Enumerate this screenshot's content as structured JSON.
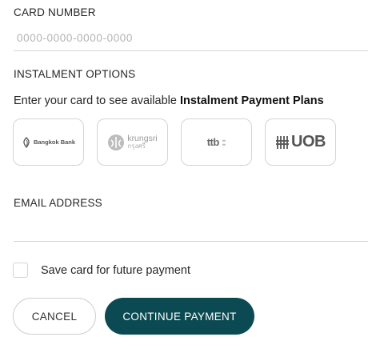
{
  "card": {
    "label": "CARD NUMBER",
    "placeholder": "0000-0000-0000-0000",
    "value": ""
  },
  "instalment": {
    "label": "INSTALMENT OPTIONS",
    "hint_prefix": "Enter your card to see available ",
    "hint_bold": "Instalment Payment Plans",
    "banks": [
      {
        "logo_text": "Bangkok Bank",
        "icon": "bangkok-bank-logo"
      },
      {
        "logo_text": "krungsri",
        "logo_sub": "กรุงศรี",
        "icon": "krungsri-logo"
      },
      {
        "logo_text": "ttb",
        "logo_sub1": "ttb",
        "logo_sub2": "ttb",
        "icon": "ttb-logo"
      },
      {
        "logo_text": "UOB",
        "icon": "uob-logo"
      }
    ]
  },
  "email": {
    "label": "EMAIL ADDRESS",
    "value": ""
  },
  "save_card": {
    "label": "Save card for future payment",
    "checked": false
  },
  "buttons": {
    "cancel": "CANCEL",
    "continue": "CONTINUE PAYMENT"
  },
  "colors": {
    "primary": "#0b4a53",
    "border": "#d4d4d4",
    "placeholder": "#b3b3b3"
  }
}
